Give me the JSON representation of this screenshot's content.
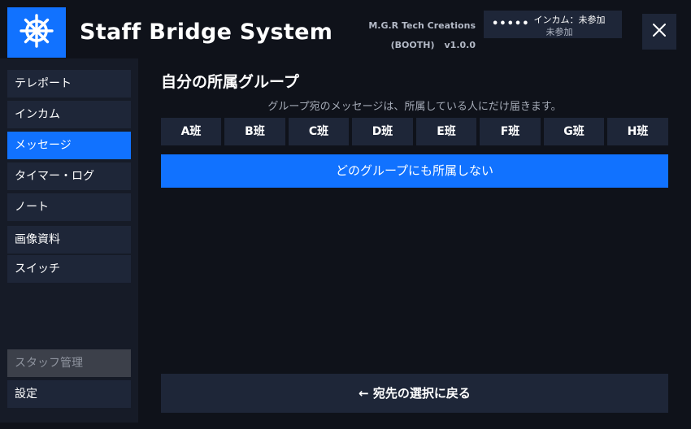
{
  "header": {
    "title": "Staff Bridge System",
    "credit_line1": "M.G.R Tech Creations",
    "credit_booth": "(BOOTH)",
    "credit_version": "v1.0.0",
    "intercom_dots": "•••••",
    "intercom_line1": "インカム：未参加",
    "intercom_line2": "未参加",
    "logo_icon": "ship-wheel-icon",
    "close_icon": "close-icon"
  },
  "sidebar": {
    "items": [
      {
        "label": "テレポート",
        "state": "normal"
      },
      {
        "label": "インカム",
        "state": "normal"
      },
      {
        "label": "メッセージ",
        "state": "active"
      },
      {
        "label": "タイマー・ログ",
        "state": "normal"
      },
      {
        "label": "ノート",
        "state": "normal"
      },
      {
        "label": "画像資料",
        "state": "normal"
      },
      {
        "label": "スイッチ",
        "state": "normal"
      }
    ],
    "bottom_items": [
      {
        "label": "スタッフ管理",
        "state": "disabled"
      },
      {
        "label": "設定",
        "state": "normal"
      }
    ]
  },
  "main": {
    "title": "自分の所属グループ",
    "hint": "グループ宛のメッセージは、所属している人にだけ届きます。",
    "groups": [
      "A班",
      "B班",
      "C班",
      "D班",
      "E班",
      "F班",
      "G班",
      "H班"
    ],
    "no_group_label": "どのグループにも所属しない",
    "back_label": "← 宛先の選択に戻る"
  },
  "colors": {
    "background": "#0f121a",
    "sidebar": "#161b27",
    "button": "#1e2638",
    "accent": "#1172ff",
    "disabled": "#3c404a"
  }
}
